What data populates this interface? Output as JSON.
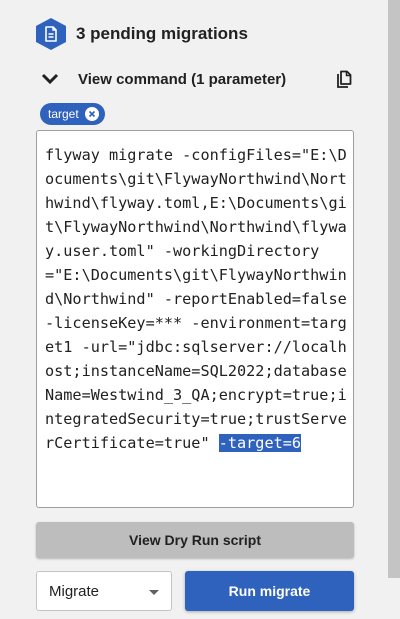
{
  "header": {
    "icon": "document-icon",
    "title": "3 pending migrations"
  },
  "command": {
    "toggle_icon": "chevron-down-icon",
    "label": "View command (1 parameter)",
    "copy_icon": "copy-icon"
  },
  "parameter_chip": {
    "label": "target",
    "remove_icon": "close-circle-icon"
  },
  "code": {
    "text": "flyway migrate -configFiles=\"E:\\Documents\\git\\FlywayNorthwind\\Northwind\\flyway.toml,E:\\Documents\\git\\FlywayNorthwind\\Northwind\\flyway.user.toml\" -workingDirectory=\"E:\\Documents\\git\\FlywayNorthwind\\Northwind\" -reportEnabled=false -licenseKey=*** -environment=target1 -url=\"jdbc:sqlserver://localhost;instanceName=SQL2022;databaseName=Westwind_3_QA;encrypt=true;integratedSecurity=true;trustServerCertificate=true\" ",
    "highlighted": "-target=6"
  },
  "actions": {
    "dry_run_label": "View Dry Run script",
    "select_value": "Migrate",
    "run_label": "Run migrate"
  },
  "colors": {
    "accent": "#2f62bc",
    "background": "#f1f1f1",
    "secondary_button": "#bdbdbd"
  }
}
